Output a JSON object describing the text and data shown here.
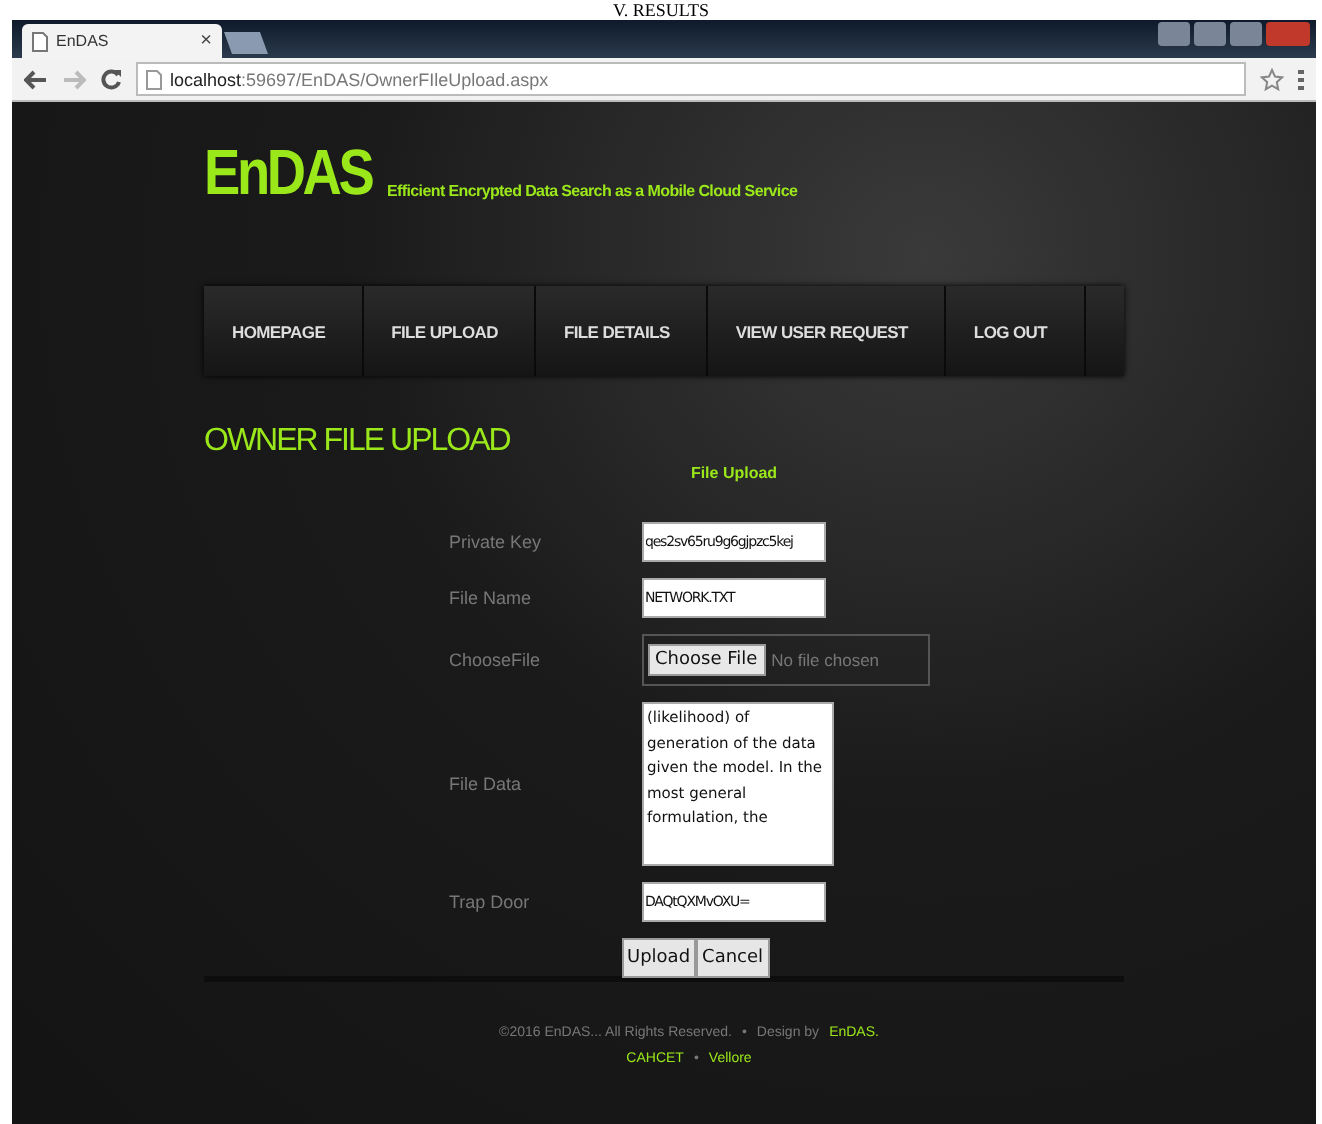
{
  "heading_fragment": "V. RESULTS",
  "browser": {
    "tab_title": "EnDAS",
    "tab_close": "×",
    "url_host": "localhost",
    "url_path": ":59697/EnDAS/OwnerFIleUpload.aspx"
  },
  "site": {
    "logo": "EnDAS",
    "tagline": "Efficient Encrypted Data Search as a Mobile Cloud Service"
  },
  "nav": [
    {
      "label": "HOMEPAGE"
    },
    {
      "label": "FILE UPLOAD"
    },
    {
      "label": "FILE DETAILS"
    },
    {
      "label": "VIEW USER REQUEST"
    },
    {
      "label": "LOG OUT"
    }
  ],
  "page_title": "OWNER FILE UPLOAD",
  "form": {
    "title": "File Upload",
    "fields": [
      {
        "kind": "text",
        "label": "Private Key",
        "value": "qes2sv65ru9g6gjpzc5kej"
      },
      {
        "kind": "text",
        "label": "File Name",
        "value": "NETWORK.TXT"
      },
      {
        "kind": "file",
        "label": "ChooseFile",
        "button": "Choose File",
        "status": "No file chosen"
      },
      {
        "kind": "textarea",
        "label": "File Data",
        "value": "(likelihood) of generation of the data given the model. In the most general formulation, the"
      },
      {
        "kind": "text",
        "label": "Trap Door",
        "value": "DAQtQXMvOXU="
      }
    ],
    "buttons": [
      "Upload",
      "Cancel"
    ]
  },
  "footer": {
    "copyright": "©2016 EnDAS... All Rights Reserved.",
    "separator": "•",
    "design_by": "Design by",
    "designer": "EnDAS.",
    "place_1": "CAHCET",
    "place_separator": "•",
    "place_2": "Vellore"
  }
}
